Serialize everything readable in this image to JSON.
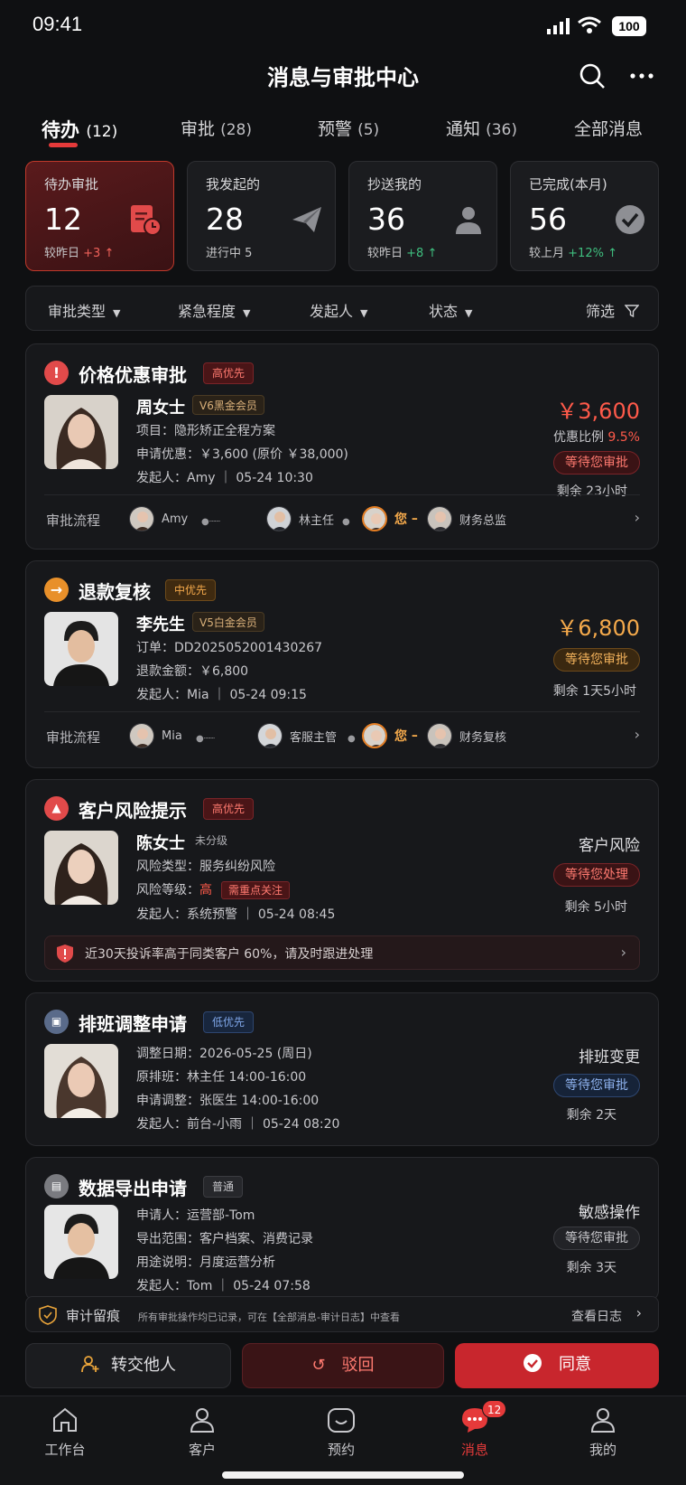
{
  "status": {
    "time": "09:41",
    "battery": "100"
  },
  "nav": {
    "title": "消息与审批中心"
  },
  "tabs": [
    {
      "label": "待办",
      "count": "(12)"
    },
    {
      "label": "审批",
      "count": "(28)"
    },
    {
      "label": "预警",
      "count": "(5)"
    },
    {
      "label": "通知",
      "count": "(36)"
    },
    {
      "label": "全部消息",
      "count": ""
    }
  ],
  "stats": [
    {
      "label": "待办审批",
      "value": "12",
      "sub": "较昨日",
      "delta": "+3 ↑"
    },
    {
      "label": "我发起的",
      "value": "28",
      "sub": "进行中 5",
      "delta": ""
    },
    {
      "label": "抄送我的",
      "value": "36",
      "sub": "较昨日",
      "delta": "+8 ↑"
    },
    {
      "label": "已完成(本月)",
      "value": "56",
      "sub": "较上月",
      "delta": "+12% ↑"
    }
  ],
  "filters": {
    "type": "审批类型",
    "urgency": "紧急程度",
    "initiator": "发起人",
    "state": "状态",
    "filter": "筛选"
  },
  "cards": [
    {
      "title": "价格优惠审批",
      "priority": "高优先",
      "name": "周女士",
      "level": "V6黑金会员",
      "line1": "项目：隐形矫正全程方案",
      "line2": "申请优惠：￥3,600 (原价 ￥38,000)",
      "line3": "发起人：Amy ｜ 05-24 10:30",
      "price": "￥3,600",
      "ratio_label": "优惠比例",
      "ratio": "9.5%",
      "status": "等待您审批",
      "remain": "剩余 23小时",
      "flow_label": "审批流程",
      "flow": [
        "Amy",
        "林主任",
        "您",
        "财务总监"
      ]
    },
    {
      "title": "退款复核",
      "priority": "中优先",
      "name": "李先生",
      "level": "V5白金会员",
      "line1": "订单：DD2025052001430267",
      "line2": "退款金额：￥6,800",
      "line3": "发起人：Mia ｜ 05-24 09:15",
      "price": "￥6,800",
      "status": "等待您审批",
      "remain": "剩余 1天5小时",
      "flow_label": "审批流程",
      "flow": [
        "Mia",
        "客服主管",
        "您",
        "财务复核"
      ]
    },
    {
      "title": "客户风险提示",
      "priority": "高优先",
      "name": "陈女士",
      "level": "未分级",
      "line1": "风险类型：服务纠纷风险",
      "line2_label": "风险等级：",
      "line2_value": "高",
      "line2_tag": "需重点关注",
      "line3": "发起人：系统预警 ｜ 05-24 08:45",
      "rtitle": "客户风险",
      "status": "等待您处理",
      "remain": "剩余 5小时",
      "alert": "近30天投诉率高于同类客户 60%，请及时跟进处理"
    },
    {
      "title": "排班调整申请",
      "priority": "低优先",
      "line0": "调整日期：2026-05-25 (周日)",
      "line1": "原排班：林主任 14:00-16:00",
      "line2": "申请调整：张医生 14:00-16:00",
      "line3": "发起人：前台-小雨 ｜ 05-24 08:20",
      "rtitle": "排班变更",
      "status": "等待您审批",
      "remain": "剩余 2天"
    },
    {
      "title": "数据导出申请",
      "priority": "普通",
      "line0": "申请人：运营部-Tom",
      "line1": "导出范围：客户档案、消费记录",
      "line2": "用途说明：月度运营分析",
      "line3": "发起人：Tom ｜ 05-24 07:58",
      "rtitle": "敏感操作",
      "status": "等待您审批",
      "remain": "剩余 3天"
    }
  ],
  "audit": {
    "title": "审计留痕",
    "desc": "所有审批操作均已记录，可在【全部消息-审计日志】中查看",
    "link": "查看日志"
  },
  "actions": {
    "transfer": "转交他人",
    "reject": "驳回",
    "approve": "同意"
  },
  "tabbar": [
    {
      "label": "工作台"
    },
    {
      "label": "客户"
    },
    {
      "label": "预约"
    },
    {
      "label": "消息",
      "badge": "12"
    },
    {
      "label": "我的"
    }
  ],
  "colors": {
    "accent": "#e53a3a",
    "bg": "#0f1012",
    "card": "#17181b",
    "orange": "#f4a94b",
    "green": "#3fbf7f"
  }
}
